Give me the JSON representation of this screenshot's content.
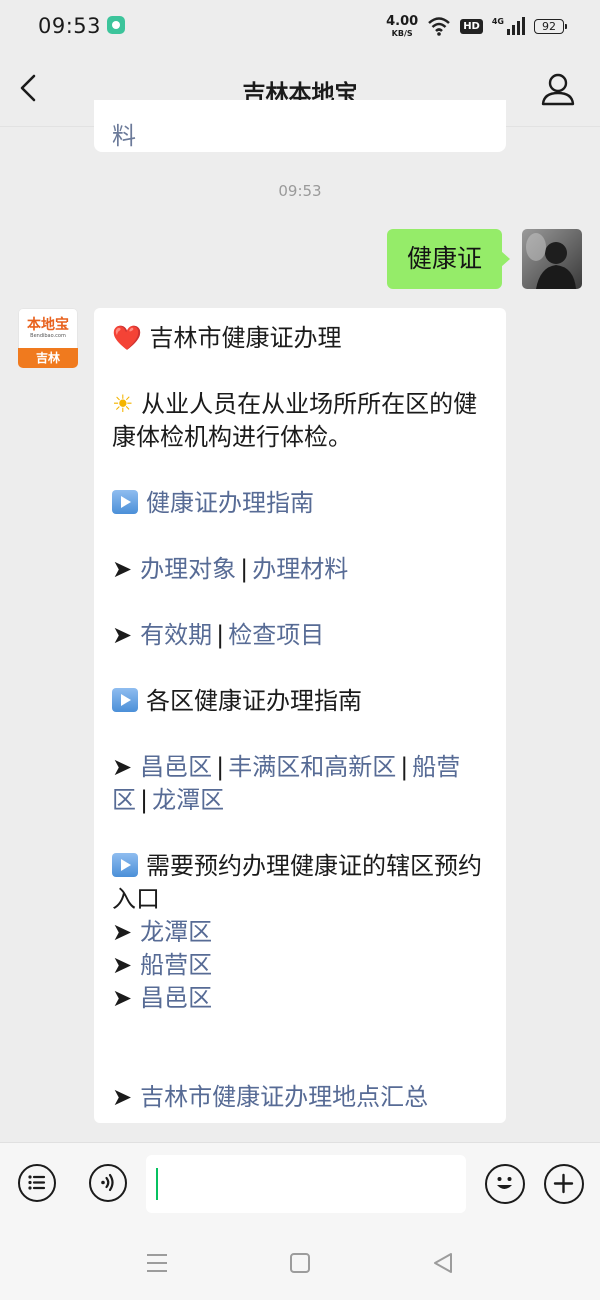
{
  "status_bar": {
    "time": "09:53",
    "network_speed": "4.00",
    "network_speed_unit": "KB/S",
    "hd_label": "HD",
    "signal_label": "4G",
    "battery": "92"
  },
  "header": {
    "title": "吉林本地宝"
  },
  "previous_message_fragment": "料",
  "timestamp": "09:53",
  "outgoing_message": {
    "text": "健康证"
  },
  "bot_avatar": {
    "logo_text": "本地宝",
    "domain_text": "Bendibao.com",
    "city_text": "吉林"
  },
  "incoming_message": {
    "title_emoji": "❤️",
    "title": "吉林市健康证办理",
    "note_emoji": "☀",
    "note": "从业人员在从业场所所在区的健康体检机构进行体检。",
    "section1": {
      "heading": "健康证办理指南",
      "row1": {
        "a": "办理对象",
        "sep": "|",
        "b": "办理材料"
      },
      "row2": {
        "a": "有效期",
        "sep": "|",
        "b": "检查项目"
      }
    },
    "section2": {
      "heading": "各区健康证办理指南",
      "districts": [
        "昌邑区",
        "丰满区和高新区",
        "船营区",
        "龙潭区"
      ],
      "sep": "|"
    },
    "section3": {
      "heading": "需要预约办理健康证的辖区预约入口",
      "items": [
        "龙潭区",
        "船营区",
        "昌邑区"
      ]
    },
    "summary_link": "吉林市健康证办理地点汇总",
    "arrow_glyph": "➤"
  },
  "icon_names": {
    "back": "back-arrow-icon",
    "profile": "user-profile-icon",
    "menu": "menu-list-icon",
    "voice": "voice-input-icon",
    "emoji": "emoji-icon",
    "add": "plus-icon"
  },
  "colors": {
    "background": "#ededed",
    "outgoing_bubble": "#95ec69",
    "link": "#576b95",
    "caret": "#07c160",
    "brand_orange": "#f07a1e"
  }
}
